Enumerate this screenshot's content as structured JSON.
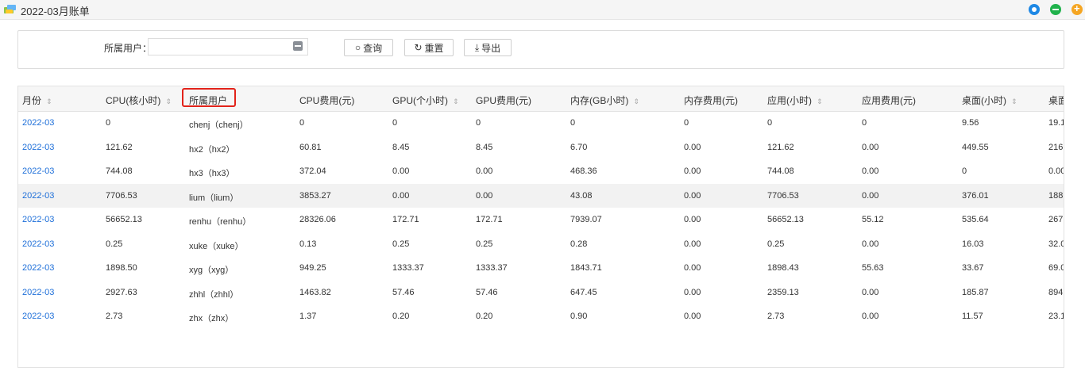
{
  "window": {
    "title": "2022-03月账单"
  },
  "search": {
    "user_label": "所属用户：",
    "user_value": "",
    "search_btn": "查询",
    "reset_btn": "重置",
    "export_btn": "导出"
  },
  "table": {
    "headers": [
      "月份",
      "CPU(核小时)",
      "所属用户",
      "CPU费用(元)",
      "GPU(个小时)",
      "GPU费用(元)",
      "内存(GB小时)",
      "内存费用(元)",
      "应用(小时)",
      "应用费用(元)",
      "桌面(小时)",
      "桌面"
    ],
    "sortable": [
      true,
      true,
      false,
      false,
      true,
      false,
      true,
      false,
      true,
      false,
      true,
      false
    ],
    "rows": [
      [
        "2022-03",
        "0",
        "chenj（chenj）",
        "0",
        "0",
        "0",
        "0",
        "0",
        "0",
        "0",
        "9.56",
        "19.1"
      ],
      [
        "2022-03",
        "121.62",
        "hx2（hx2）",
        "60.81",
        "8.45",
        "8.45",
        "6.70",
        "0.00",
        "121.62",
        "0.00",
        "449.55",
        "216"
      ],
      [
        "2022-03",
        "744.08",
        "hx3（hx3）",
        "372.04",
        "0.00",
        "0.00",
        "468.36",
        "0.00",
        "744.08",
        "0.00",
        "0",
        "0.00"
      ],
      [
        "2022-03",
        "7706.53",
        "lium（lium）",
        "3853.27",
        "0.00",
        "0.00",
        "43.08",
        "0.00",
        "7706.53",
        "0.00",
        "376.01",
        "188"
      ],
      [
        "2022-03",
        "56652.13",
        "renhu（renhu）",
        "28326.06",
        "172.71",
        "172.71",
        "7939.07",
        "0.00",
        "56652.13",
        "55.12",
        "535.64",
        "267"
      ],
      [
        "2022-03",
        "0.25",
        "xuke（xuke）",
        "0.13",
        "0.25",
        "0.25",
        "0.28",
        "0.00",
        "0.25",
        "0.00",
        "16.03",
        "32.0"
      ],
      [
        "2022-03",
        "1898.50",
        "xyg（xyg）",
        "949.25",
        "1333.37",
        "1333.37",
        "1843.71",
        "0.00",
        "1898.43",
        "55.63",
        "33.67",
        "69.0"
      ],
      [
        "2022-03",
        "2927.63",
        "zhhl（zhhl）",
        "1463.82",
        "57.46",
        "57.46",
        "647.45",
        "0.00",
        "2359.13",
        "0.00",
        "185.87",
        "894"
      ],
      [
        "2022-03",
        "2.73",
        "zhx（zhx）",
        "1.37",
        "0.20",
        "0.20",
        "0.90",
        "0.00",
        "2.73",
        "0.00",
        "11.57",
        "23.1"
      ]
    ]
  },
  "colors": {
    "link": "#1e6fd9",
    "highlight": "#e2231a",
    "header_bg": "#f6f6f6"
  }
}
